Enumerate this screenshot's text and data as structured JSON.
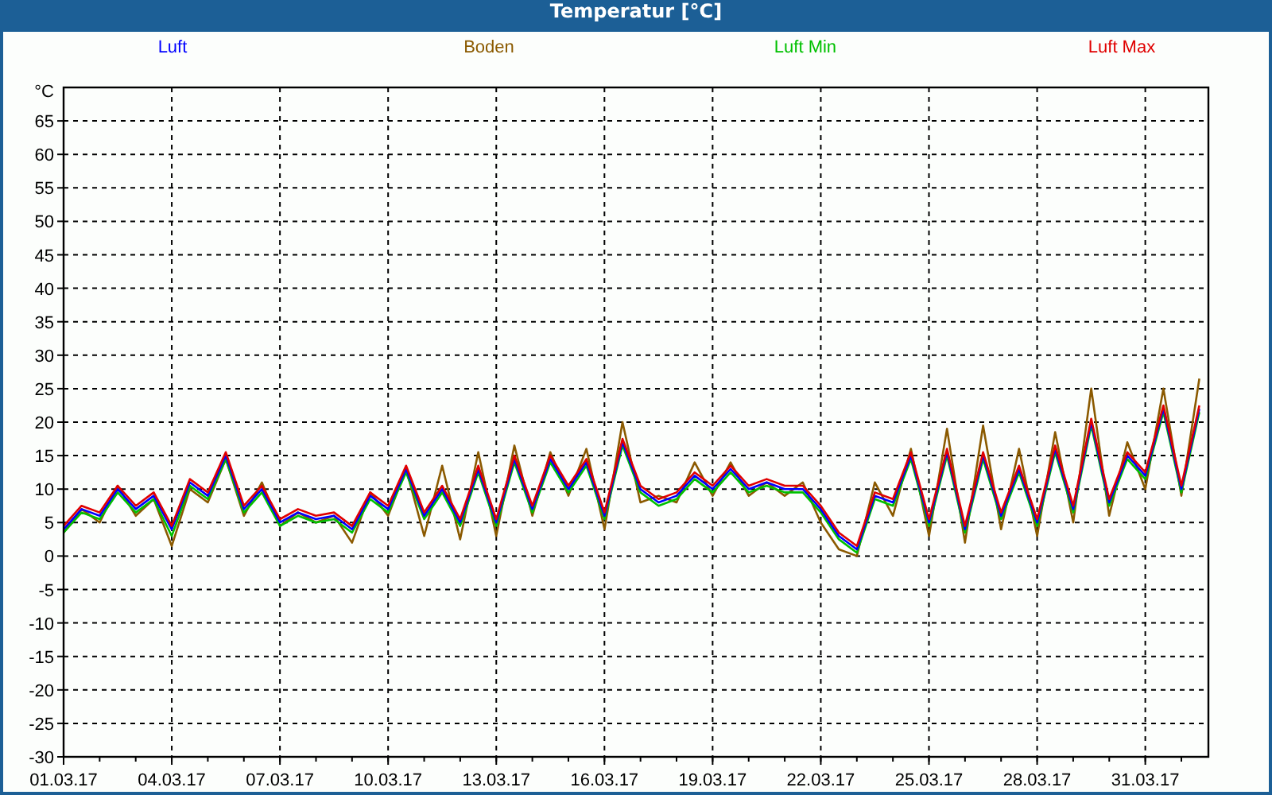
{
  "window": {
    "title": "Temperatur [°C]"
  },
  "chart": {
    "chart_data": {
      "type": "line",
      "ylabel": "°C",
      "categories": [
        "01.03.17",
        null,
        null,
        null,
        null,
        null,
        "04.03.17",
        null,
        null,
        null,
        null,
        null,
        "07.03.17",
        null,
        null,
        null,
        null,
        null,
        "10.03.17",
        null,
        null,
        null,
        null,
        null,
        "13.03.17",
        null,
        null,
        null,
        null,
        null,
        "16.03.17",
        null,
        null,
        null,
        null,
        null,
        "19.03.17",
        null,
        null,
        null,
        null,
        null,
        "22.03.17",
        null,
        null,
        null,
        null,
        null,
        "25.03.17",
        null,
        null,
        null,
        null,
        null,
        "28.03.17",
        null,
        null,
        null,
        null,
        null,
        "31.03.17",
        null,
        null,
        null
      ],
      "series": [
        {
          "name": "Luft",
          "color": "#0000ff",
          "values": [
            4,
            7,
            6,
            10,
            7,
            9,
            4,
            11,
            9,
            15,
            7,
            10,
            5,
            6.5,
            5.5,
            6,
            4,
            9,
            7,
            13,
            6,
            10,
            5,
            13,
            5,
            14.5,
            7,
            14.5,
            10,
            14,
            6,
            17,
            10,
            8,
            9,
            12,
            10,
            13,
            10,
            11,
            10,
            10,
            7,
            3,
            1,
            9,
            8,
            15,
            5,
            15.5,
            4,
            15,
            6,
            13,
            5,
            16,
            7,
            20,
            8,
            15,
            12,
            22,
            10,
            22
          ]
        },
        {
          "name": "Boden",
          "color": "#8b5a00",
          "values": [
            3.5,
            7,
            5,
            10.5,
            6,
            8.5,
            1.5,
            10,
            8,
            14.5,
            6,
            11,
            4.5,
            6.5,
            5,
            6,
            2,
            9.5,
            6,
            13,
            3,
            13.5,
            2.5,
            15.5,
            3,
            16.5,
            6,
            15.5,
            9,
            16,
            4,
            20,
            8,
            9,
            8,
            14,
            9,
            14,
            9,
            11,
            9,
            11,
            5,
            1,
            0,
            11,
            6,
            16,
            3,
            19,
            2,
            19.5,
            4,
            16,
            3,
            18.5,
            5,
            25,
            6,
            17,
            10,
            25,
            9,
            26.5
          ]
        },
        {
          "name": "Luft Min",
          "color": "#00c000",
          "values": [
            3.5,
            6.5,
            5.5,
            9.5,
            6.5,
            8.5,
            3,
            10.5,
            8.5,
            14.5,
            6.5,
            9.5,
            4.5,
            6,
            5,
            5.5,
            3.5,
            8.5,
            6.5,
            12.5,
            5.5,
            9.5,
            4.5,
            12.5,
            4.5,
            14,
            6.5,
            14,
            9.5,
            13.5,
            5.5,
            16.5,
            9.5,
            7.5,
            8.5,
            11.5,
            9.5,
            12.5,
            9.5,
            10.5,
            9.5,
            9.5,
            6.5,
            2.5,
            0.5,
            8.5,
            7.5,
            14.5,
            4.5,
            15,
            3.5,
            14.5,
            5.5,
            12.5,
            4.5,
            15.5,
            6.5,
            19.5,
            7.5,
            14.5,
            11.5,
            21.5,
            9.5,
            21.5
          ]
        },
        {
          "name": "Luft Max",
          "color": "#e00000",
          "values": [
            4.5,
            7.5,
            6.5,
            10.5,
            7.5,
            9.5,
            4.5,
            11.5,
            9.5,
            15.5,
            7.5,
            10.5,
            5.5,
            7,
            6,
            6.5,
            4.5,
            9.5,
            7.5,
            13.5,
            6.5,
            10.5,
            5.5,
            13.5,
            5.5,
            15,
            7.5,
            15,
            10.5,
            14.5,
            6.5,
            17.5,
            10.5,
            8.5,
            9.5,
            12.5,
            10.5,
            13.5,
            10.5,
            11.5,
            10.5,
            10.5,
            7.5,
            3.5,
            1.5,
            9.5,
            8.5,
            15.5,
            5.5,
            16,
            4.5,
            15.5,
            6.5,
            13.5,
            5.5,
            16.5,
            7.5,
            20.5,
            8.5,
            15.5,
            12.5,
            22.5,
            10.5,
            22.5
          ]
        }
      ],
      "grid": true,
      "ylim": [
        -30,
        70
      ],
      "yticks": [
        -30,
        -25,
        -20,
        -15,
        -10,
        -5,
        0,
        5,
        10,
        15,
        20,
        25,
        30,
        35,
        40,
        45,
        50,
        55,
        60,
        65
      ]
    }
  }
}
